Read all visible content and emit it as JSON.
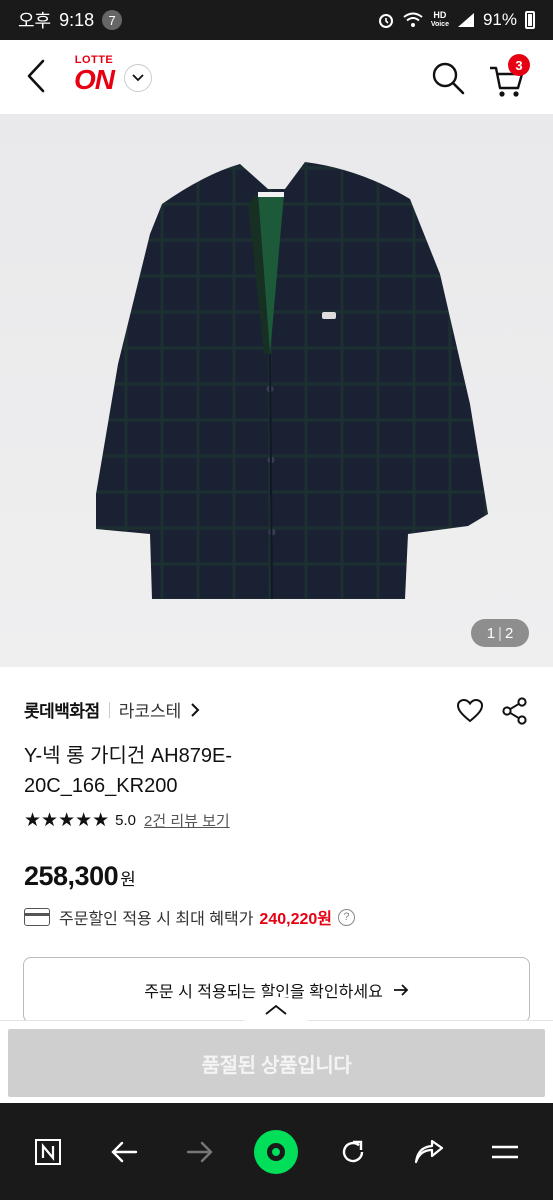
{
  "status_bar": {
    "period": "오후",
    "time": "9:18",
    "notification_count": "7",
    "network_hd": "HD",
    "network_voice": "Voice",
    "battery": "91%"
  },
  "header": {
    "logo_top": "LOTTE",
    "logo_bottom": "ON",
    "cart_count": "3"
  },
  "gallery": {
    "current": "1",
    "separator": "|",
    "total": "2"
  },
  "product": {
    "store": "롯데백화점",
    "brand": "라코스테",
    "title": "Y-넥 롱 가디건 AH879E-20C_166_KR200",
    "stars": "★★★★★",
    "rating": "5.0",
    "review_link": "2건 리뷰 보기",
    "price": "258,300",
    "currency": "원",
    "benefit_text": "주문할인 적용 시 최대 혜택가",
    "benefit_price": "240,220원",
    "discount_button": "주문 시 적용되는 할인을 확인하세요"
  },
  "bottom": {
    "soldout_label": "품절된 상품입니다"
  },
  "colors": {
    "brand_red": "#e60012",
    "naver_green": "#00de5a"
  }
}
